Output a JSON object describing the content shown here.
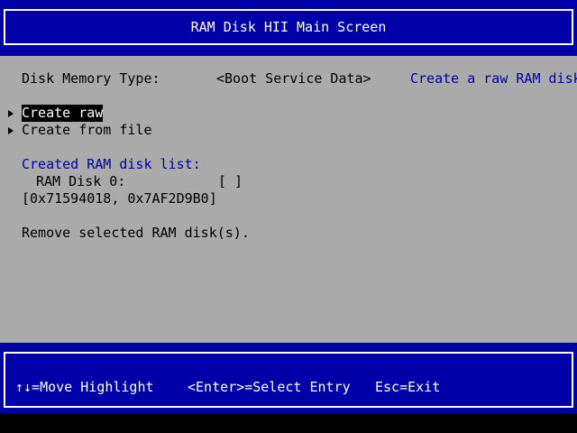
{
  "header": {
    "title": "RAM Disk HII Main Screen"
  },
  "form": {
    "memory_type_label": "Disk Memory Type:",
    "memory_type_value": "<Boot Service Data>",
    "help_text": "Create a raw RAM disk.",
    "actions": [
      "Create raw",
      "Create from file"
    ],
    "list_heading": "Created RAM disk list:",
    "disk_label": "RAM Disk 0:",
    "disk_checkbox": "[ ]",
    "disk_range": "[0x71594018, 0x7AF2D9B0]",
    "remove_label": "Remove selected RAM disk(s)."
  },
  "footer": {
    "move_hint": "↑↓=Move Highlight",
    "select_hint": "<Enter>=Select Entry",
    "exit_hint": "Esc=Exit"
  },
  "colors": {
    "band": "#0000a8",
    "body_bg": "#aaaaaa",
    "accent_text": "#0000a8",
    "highlight_bg": "#000000",
    "highlight_fg": "#ffffff"
  }
}
